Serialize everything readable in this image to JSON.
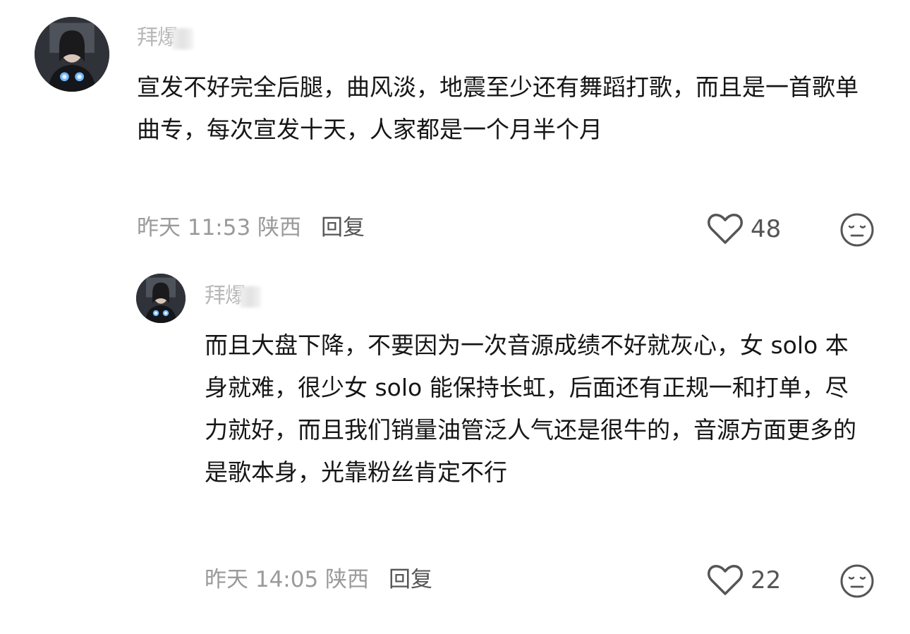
{
  "comments": [
    {
      "username": "拜爆",
      "text": "宣发不好完全后腿，曲风淡，地震至少还有舞蹈打歌，而且是一首歌单曲专，每次宣发十天，人家都是一个月半个月",
      "time": "昨天 11:53 陕西",
      "reply_label": "回复",
      "likes": "48"
    },
    {
      "username": "拜爆",
      "text": "而且大盘下降，不要因为一次音源成绩不好就灰心，女 solo 本身就难，很少女 solo 能保持长虹，后面还有正规一和打单，尽力就好，而且我们销量油管泛人气还是很牛的，音源方面更多的是歌本身，光靠粉丝肯定不行",
      "time": "昨天 14:05 陕西",
      "reply_label": "回复",
      "likes": "22"
    }
  ],
  "icons": {
    "like": "heart-outline-icon",
    "dislike": "meh-face-icon"
  },
  "colors": {
    "text": "#161616",
    "meta": "#9a9a9a",
    "reply": "#555555"
  }
}
